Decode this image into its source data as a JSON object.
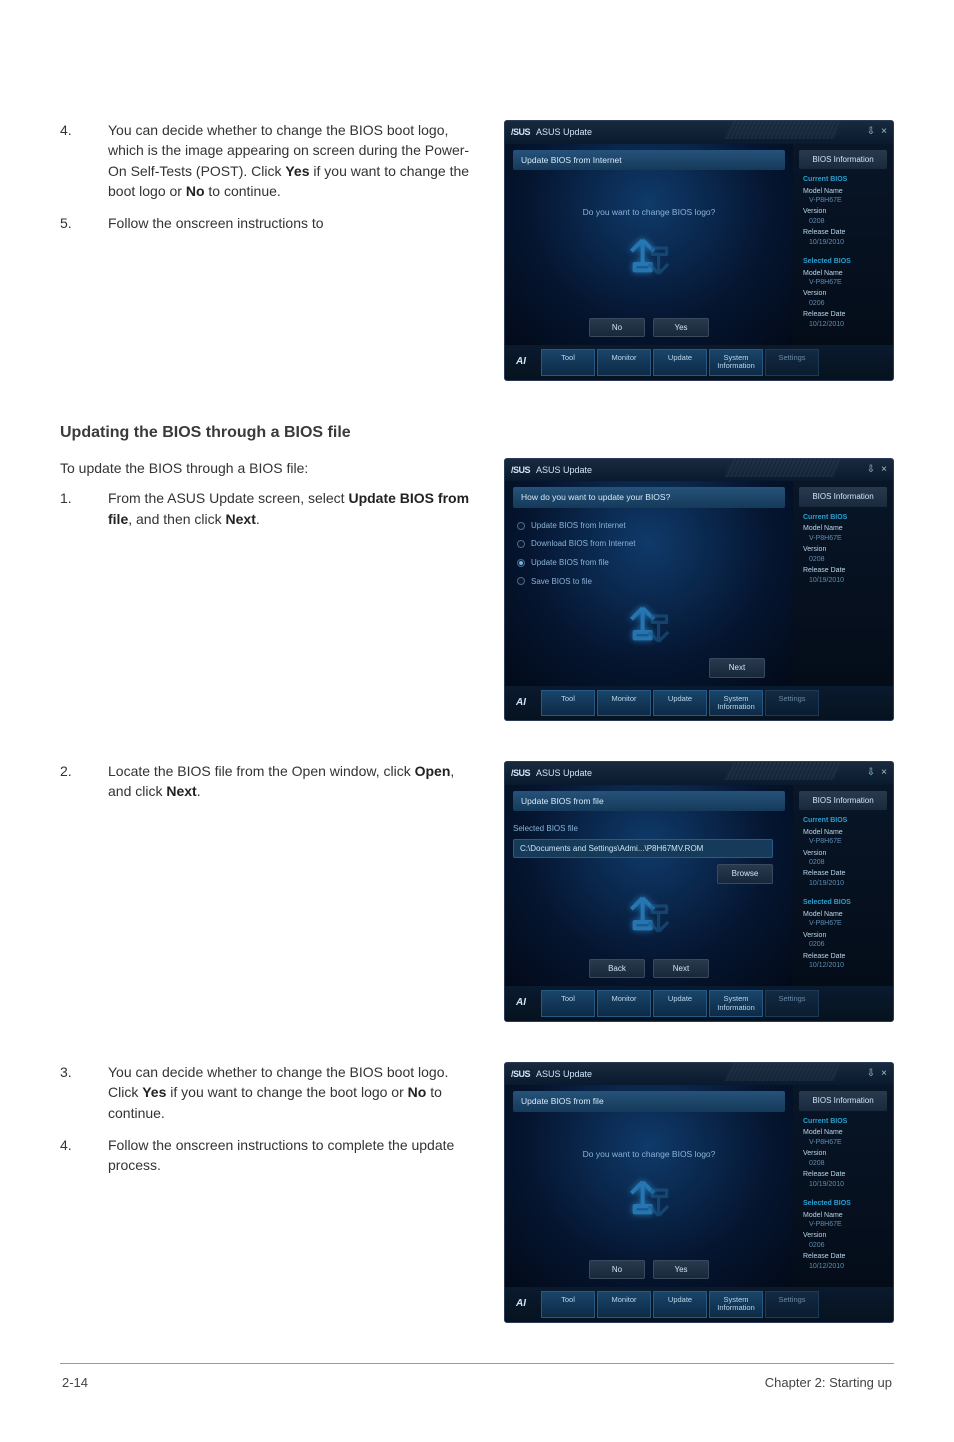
{
  "footer": {
    "left": "2-14",
    "right": "Chapter 2: Starting up"
  },
  "section1": {
    "steps": [
      {
        "n": "4.",
        "html": "You can decide whether to change the BIOS boot logo, which is the image appearing on screen during the Power-On Self-Tests (POST). Click <b>Yes</b> if you want to change the boot logo or <b>No</b> to continue."
      },
      {
        "n": "5.",
        "html": "Follow the onscreen instructions to"
      }
    ]
  },
  "section2": {
    "heading": "Updating the BIOS through a BIOS file",
    "lead": "To update the BIOS through a BIOS file:",
    "steps": [
      {
        "n": "1.",
        "html": "From the ASUS Update screen, select <b>Update BIOS from file</b>, and then click <b>Next</b>."
      }
    ],
    "steps2": [
      {
        "n": "2.",
        "html": "Locate the BIOS file from the Open window, click <b>Open</b>, and click <b>Next</b>."
      }
    ],
    "steps3": [
      {
        "n": "3.",
        "html": "You can decide whether to change the BIOS boot logo. Click <b>Yes</b> if you want to change the boot logo or <b>No</b> to continue."
      },
      {
        "n": "4.",
        "html": "Follow the onscreen instructions to complete the update process."
      }
    ]
  },
  "asus_common": {
    "logo": "/SUS",
    "title": "ASUS Update",
    "pin_icon": "⇩",
    "close_icon": "×",
    "side_header": "BIOS Information",
    "current": {
      "hdr": "Current BIOS",
      "model_lbl": "Model Name",
      "model_val": "V-P8H67E",
      "ver_lbl": "Version",
      "ver_val": "0208",
      "rel_lbl": "Release Date",
      "rel_val": "10/19/2010"
    },
    "selected": {
      "hdr": "Selected BIOS",
      "model_lbl": "Model Name",
      "model_val": "V-P8H67E",
      "ver_lbl": "Version",
      "ver_val": "0206",
      "rel_lbl": "Release Date",
      "rel_val": "10/12/2010"
    },
    "tabs": {
      "tool": "Tool",
      "monitor": "Monitor",
      "update": "Update",
      "sysinfo": "System\nInformation",
      "settings": "Settings"
    }
  },
  "win1": {
    "header": "Update BIOS from Internet",
    "prompt": "Do you want to change BIOS logo?",
    "no": "No",
    "yes": "Yes"
  },
  "win2": {
    "header": "How do you want to update your BIOS?",
    "opts": [
      "Update BIOS from Internet",
      "Download BIOS from Internet",
      "Update BIOS from file",
      "Save BIOS to file"
    ],
    "selected_index": 2,
    "next": "Next"
  },
  "win3": {
    "header": "Update BIOS from file",
    "file_label": "Selected BIOS file",
    "file_path": "C:\\Documents and Settings\\Admi...\\P8H67MV.ROM",
    "browse": "Browse",
    "back": "Back",
    "next": "Next"
  },
  "win4": {
    "header": "Update BIOS from file",
    "prompt": "Do you want to change BIOS logo?",
    "no": "No",
    "yes": "Yes"
  }
}
